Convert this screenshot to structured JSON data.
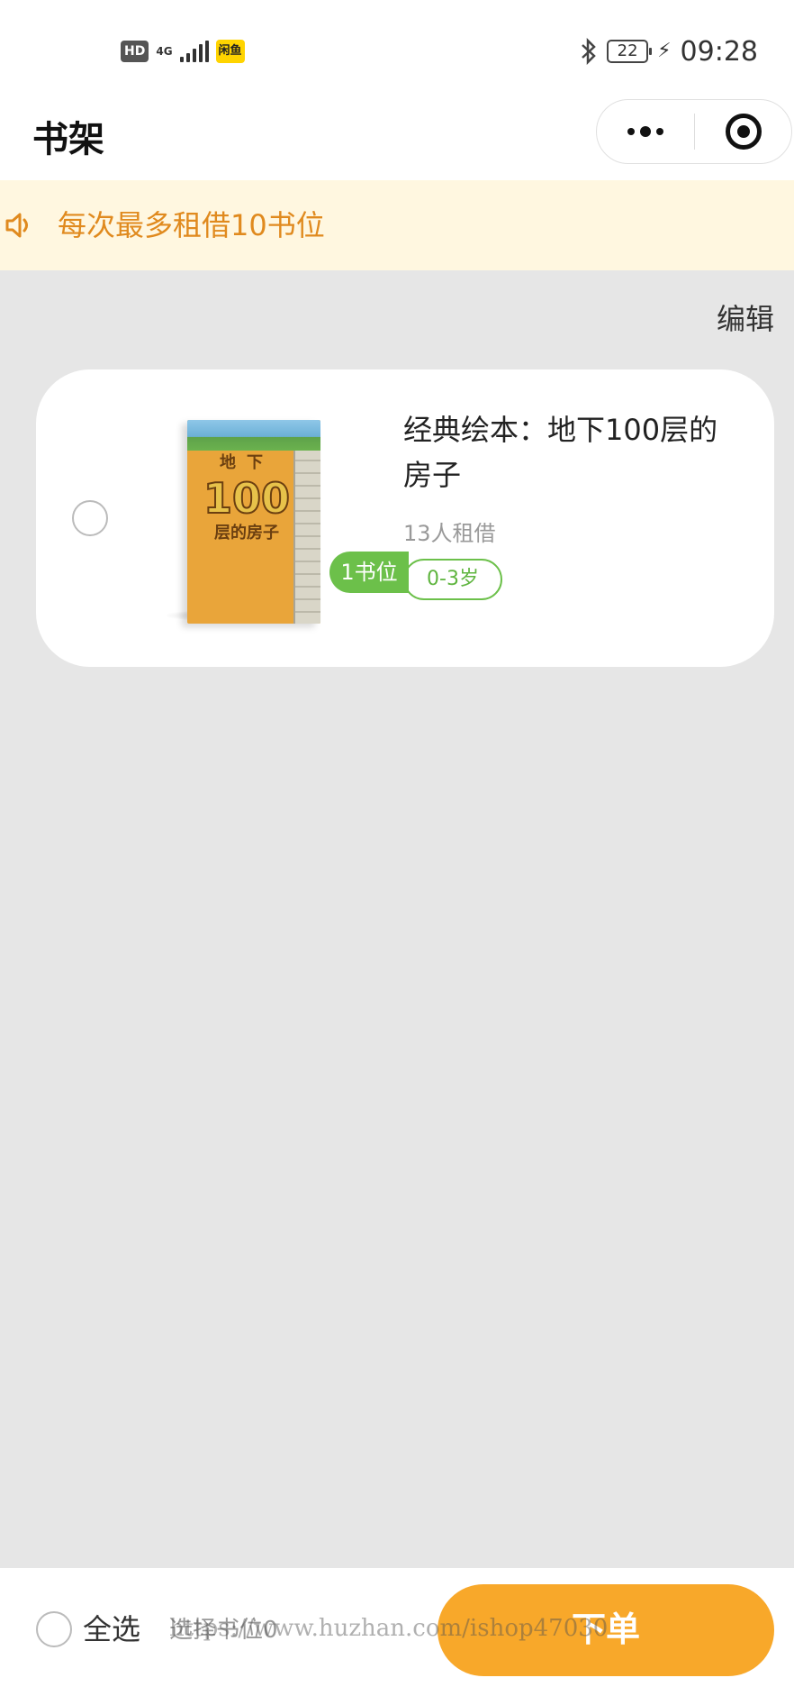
{
  "status_bar": {
    "hd_label": "HD",
    "network_label": "4G",
    "app_badge": "闲鱼",
    "battery": "22",
    "time": "09:28"
  },
  "nav": {
    "title": "书架"
  },
  "notice": {
    "text": "每次最多租借10书位",
    "icon": "speaker-icon",
    "text_color": "#e08a1e",
    "background": "#fff7e0"
  },
  "edit_label": "编辑",
  "books": [
    {
      "title": "经典绘本：地下100层的房子",
      "borrow_count": "13人租借",
      "age_tag": "0-3岁",
      "slot_badge": "1书位",
      "cover_text": {
        "line1": "地下",
        "line2": "100",
        "line3": "层的房子"
      },
      "selected": false
    }
  ],
  "bottom_bar": {
    "select_all_label": "全选",
    "selected_slots": "选择书位0",
    "order_button": "下单",
    "watermark": "https://www.huzhan.com/ishop47030",
    "accent_color": "#f8a82a"
  },
  "colors": {
    "page_background": "#e6e6e6",
    "tag_green": "#6cc04a"
  }
}
